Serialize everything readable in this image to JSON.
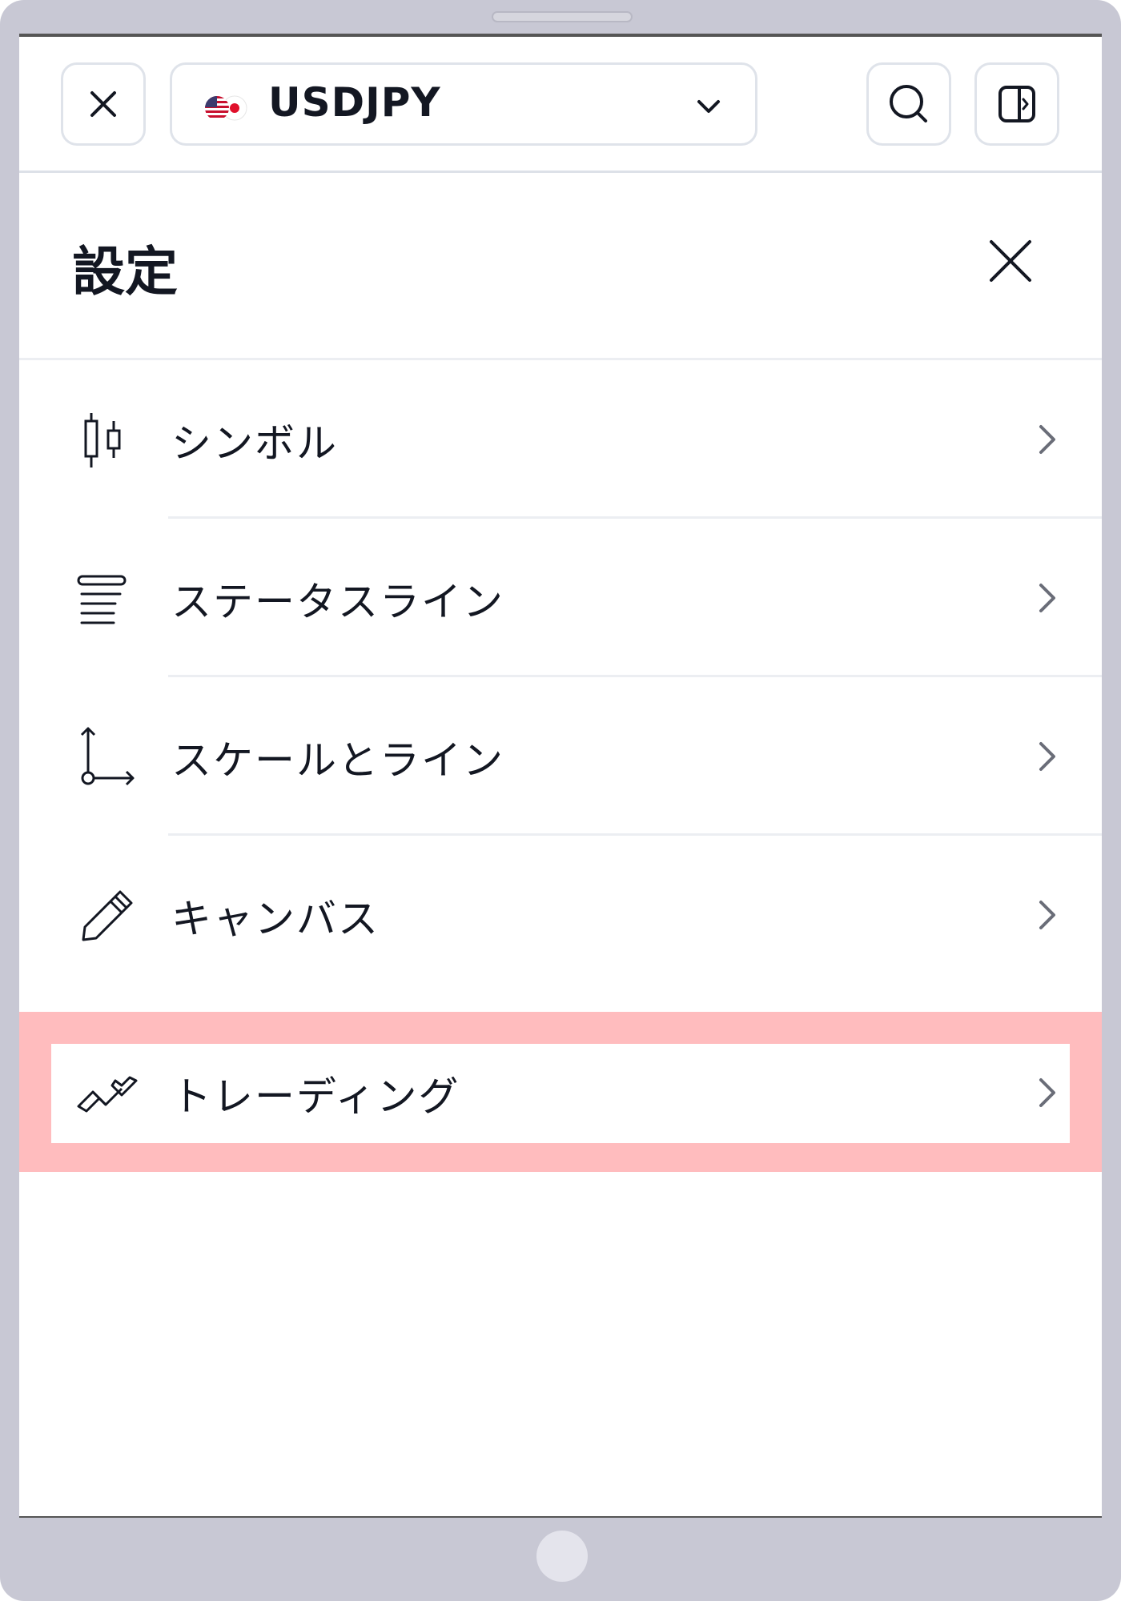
{
  "topbar": {
    "symbol": "USDJPY",
    "icons": {
      "close": "close-icon",
      "flags": "us-jp-flag-icon",
      "dropdown": "chevron-down-icon",
      "search": "search-icon",
      "panel": "side-panel-icon"
    }
  },
  "settings": {
    "title": "設定",
    "close_icon": "close-icon",
    "items": [
      {
        "label": "シンボル",
        "icon": "candlestick-icon"
      },
      {
        "label": "ステータスライン",
        "icon": "status-line-icon"
      },
      {
        "label": "スケールとライン",
        "icon": "scales-axis-icon"
      },
      {
        "label": "キャンバス",
        "icon": "pencil-icon"
      },
      {
        "label": "トレーディング",
        "icon": "trading-icon"
      }
    ]
  },
  "colors": {
    "text": "#131722",
    "border": "#dfe3ea",
    "highlight": "#ffbcbe",
    "device": "#c8c8d4"
  }
}
